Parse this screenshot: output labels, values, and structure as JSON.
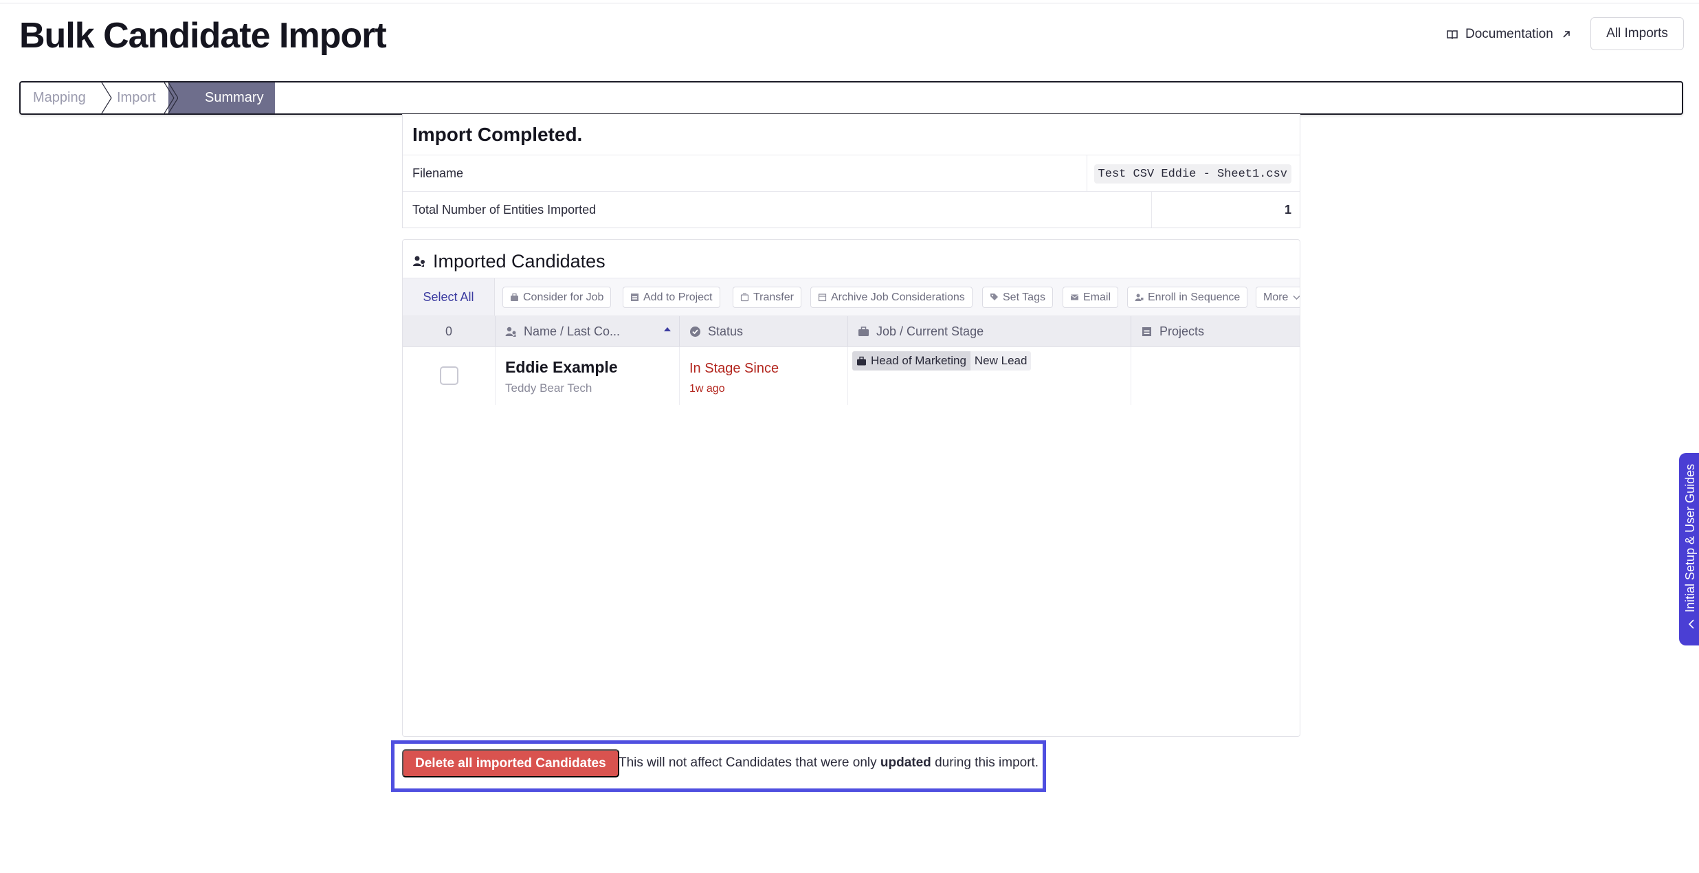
{
  "header": {
    "title": "Bulk Candidate Import",
    "documentation_label": "Documentation",
    "all_imports_label": "All Imports"
  },
  "stepper": {
    "steps": [
      {
        "label": "Mapping",
        "state": "completed"
      },
      {
        "label": "Import",
        "state": "completed"
      },
      {
        "label": "Summary",
        "state": "active"
      }
    ]
  },
  "summary": {
    "title": "Import Completed.",
    "rows": [
      {
        "label": "Filename",
        "value": "Test CSV Eddie - Sheet1.csv"
      },
      {
        "label": "Total Number of Entities Imported",
        "value": "1"
      }
    ]
  },
  "candidates": {
    "title": "Imported Candidates",
    "select_all_label": "Select All",
    "toolbar": [
      {
        "label": "Consider for Job",
        "icon": "briefcase-icon"
      },
      {
        "label": "Add to Project",
        "icon": "project-icon"
      },
      {
        "label": "Transfer",
        "icon": "transfer-icon"
      },
      {
        "label": "Archive Job Considerations",
        "icon": "archive-icon"
      },
      {
        "label": "Set Tags",
        "icon": "tag-icon"
      },
      {
        "label": "Email",
        "icon": "envelope-icon"
      },
      {
        "label": "Enroll in Sequence",
        "icon": "sequence-icon"
      },
      {
        "label": "More",
        "icon": "chevron-down-icon"
      }
    ],
    "columns": {
      "count": "0",
      "name": "Name / Last Co...",
      "status": "Status",
      "job": "Job / Current Stage",
      "projects": "Projects"
    },
    "rows": [
      {
        "name": "Eddie Example",
        "company": "Teddy Bear Tech",
        "status": "In Stage Since",
        "status_time": "1w ago",
        "job": "Head of Marketing",
        "stage": "New Lead",
        "projects": ""
      }
    ]
  },
  "delete": {
    "button_label": "Delete all imported Candidates",
    "note_prefix": "This will not affect Candidates that were only",
    "note_bold": "updated",
    "note_suffix": "during this import."
  },
  "side_tab": {
    "label": "Initial Setup & User Guides"
  },
  "colors": {
    "accent": "#4f4fe0",
    "stepper_active": "#6e6e8c",
    "danger": "#d9534f",
    "status_red": "#b3261e",
    "side_tab": "#4a3fd4"
  }
}
